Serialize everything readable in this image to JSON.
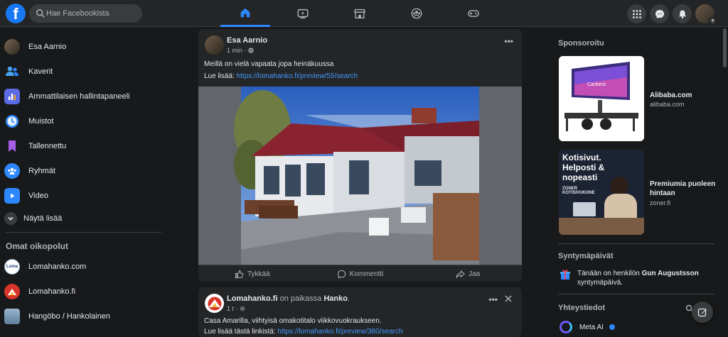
{
  "header": {
    "logo_letter": "f",
    "search_placeholder": "Hae Facebookista",
    "nav_tabs": [
      "home-icon",
      "video-icon",
      "marketplace-icon",
      "groups-icon",
      "gaming-icon"
    ],
    "right_icons": [
      "menu-grid-icon",
      "messenger-icon",
      "notifications-icon"
    ]
  },
  "sidebar": {
    "items": [
      {
        "label": "Esa Aarnio",
        "icon": "profile-avatar"
      },
      {
        "label": "Kaverit",
        "icon": "friends-icon"
      },
      {
        "label": "Ammattilaisen hallintapaneeli",
        "icon": "dashboard-icon"
      },
      {
        "label": "Muistot",
        "icon": "memories-icon"
      },
      {
        "label": "Tallennettu",
        "icon": "saved-icon"
      },
      {
        "label": "Ryhmät",
        "icon": "groups-icon"
      },
      {
        "label": "Video",
        "icon": "video-icon"
      },
      {
        "label": "Näytä lisää",
        "icon": "chevron-down-icon"
      }
    ],
    "shortcuts_title": "Omat oikopolut",
    "shortcuts": [
      {
        "label": "Lomahanko.com"
      },
      {
        "label": "Lomahanko.fi"
      },
      {
        "label": "Hangöbo / Hankolainen"
      }
    ]
  },
  "feed": {
    "post1": {
      "author": "Esa Aarnio",
      "time": "1 min",
      "text": "Meillä on vielä vapaata jopa heinäkuussa",
      "link_prefix": "Lue lisää: ",
      "link": "https://lomahanko.fi/preview/55/search",
      "actions": {
        "like": "Tykkää",
        "comment": "Kommentti",
        "share": "Jaa"
      }
    },
    "post2": {
      "author": "Lomahanko.fi",
      "location_prefix": " on paikassa ",
      "location": "Hanko",
      "location_suffix": ".",
      "time": "1 t",
      "text": "Casa Amarilla, viihtyisä omakotitalo viikkovuokraukseen.",
      "link_prefix": "Lue lisää tästä linkistä: ",
      "link": "https://lomahanko.fi/preview/380/search"
    }
  },
  "rightbar": {
    "sponsored_title": "Sponsoroitu",
    "ads": [
      {
        "title": "Alibaba.com",
        "url": "alibaba.com",
        "image_text": "Canbest"
      },
      {
        "title": "Premiumia puoleen hintaan",
        "url": "zoner.fi",
        "image_text": "Kotisivut. Helposti & nopeasti",
        "image_sub": "ZONER KOTISIVUKONE"
      }
    ],
    "birthdays_title": "Syntymäpäivät",
    "birthday_prefix": "Tänään on henkilön ",
    "birthday_name": "Gun Augustsson",
    "birthday_suffix": " syntymäpäivä.",
    "contacts_title": "Yhteystiedot",
    "contacts": [
      {
        "name": "Meta AI"
      }
    ]
  },
  "colors": {
    "accent": "#1877f2",
    "link": "#4599ff",
    "background": "#18191a",
    "card": "#242526"
  }
}
